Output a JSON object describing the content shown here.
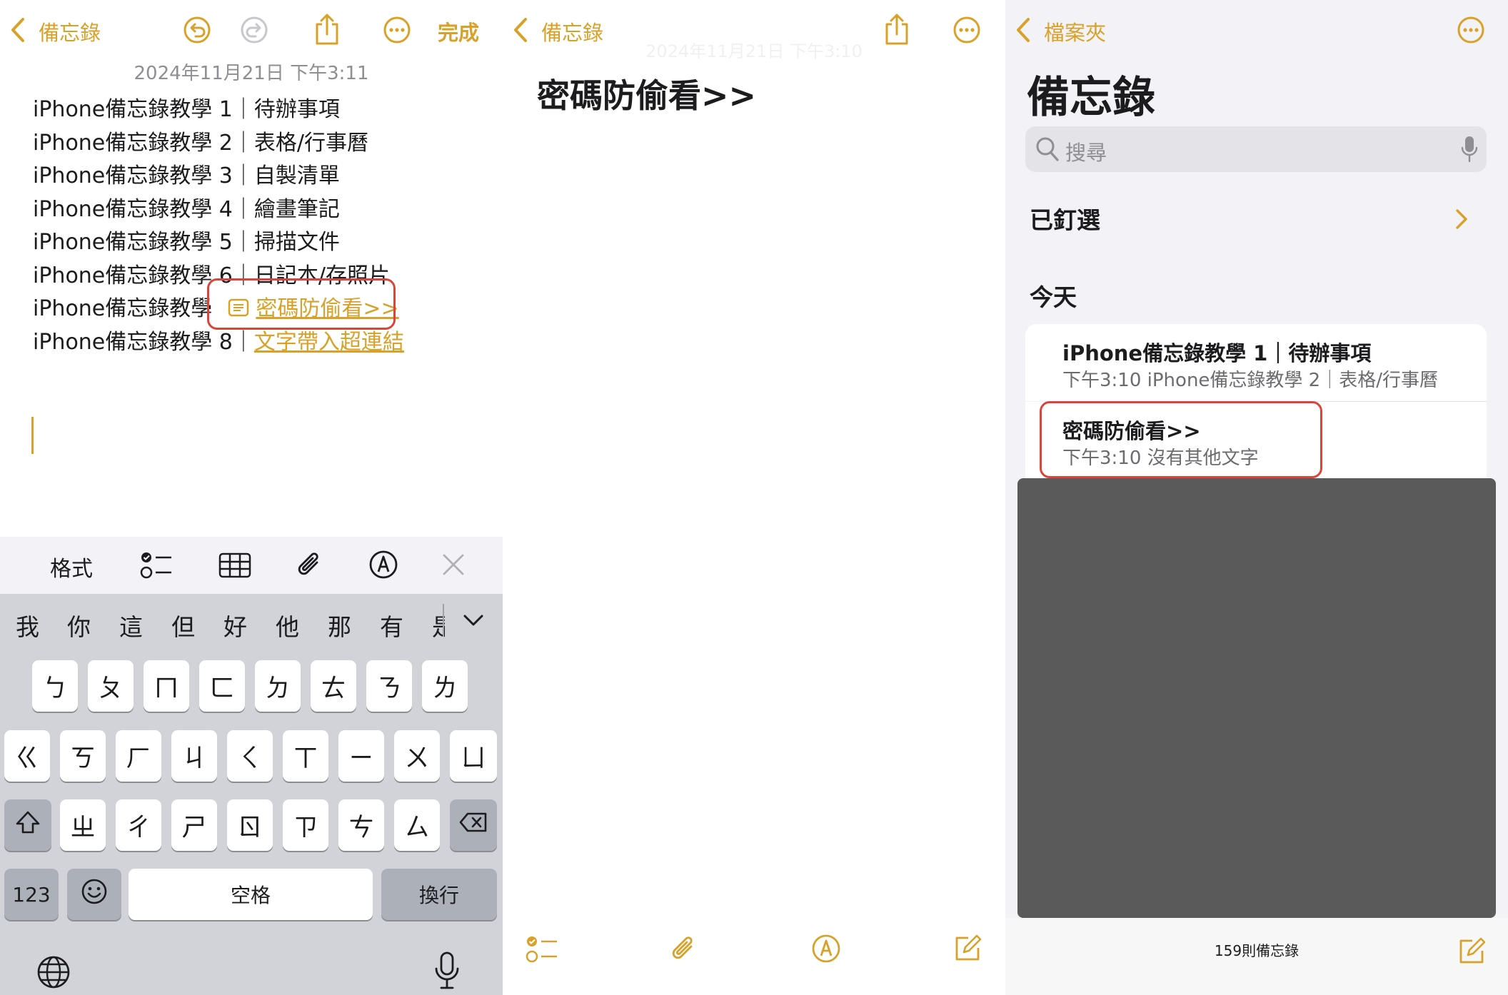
{
  "colors": {
    "accent": "#d8a22a",
    "highlight": "#d9453b",
    "overlay": "#5a5a5a"
  },
  "panel1": {
    "nav": {
      "back_label": "備忘錄",
      "done_label": "完成"
    },
    "date": "2024年11月21日 下午3:11",
    "lines": [
      {
        "prefix": "iPhone備忘錄教學 1｜待辦事項",
        "link": ""
      },
      {
        "prefix": "iPhone備忘錄教學 2｜表格/行事曆",
        "link": ""
      },
      {
        "prefix": "iPhone備忘錄教學 3｜自製清單",
        "link": ""
      },
      {
        "prefix": "iPhone備忘錄教學 4｜繪畫筆記",
        "link": ""
      },
      {
        "prefix": "iPhone備忘錄教學 5｜掃描文件",
        "link": ""
      },
      {
        "prefix": "iPhone備忘錄教學 6｜日記本/存照片",
        "link": ""
      },
      {
        "prefix": "iPhone備忘錄教學",
        "link": "密碼防偷看>>"
      },
      {
        "prefix": "iPhone備忘錄教學 8｜",
        "link": "文字帶入超連結"
      }
    ],
    "toolbar": {
      "format_label": "格式"
    },
    "keyboard": {
      "candidates": [
        "我",
        "你",
        "這",
        "但",
        "好",
        "他",
        "那",
        "有",
        "是"
      ],
      "row1": [
        "ㄅ",
        "ㄆ",
        "ㄇ",
        "ㄈ",
        "ㄉ",
        "ㄊ",
        "ㄋ",
        "ㄌ"
      ],
      "row2": [
        "ㄍ",
        "ㄎ",
        "ㄏ",
        "ㄐ",
        "ㄑ",
        "ㄒ",
        "ㄧ",
        "ㄨ",
        "ㄩ"
      ],
      "row3": [
        "ㄓ",
        "ㄔ",
        "ㄕ",
        "ㄖ",
        "ㄗ",
        "ㄘ",
        "ㄙ"
      ],
      "numbers_label": "123",
      "space_label": "空格",
      "return_label": "換行"
    }
  },
  "panel2": {
    "nav": {
      "back_label": "備忘錄"
    },
    "ghost_date": "2024年11月21日 下午3:10",
    "title": "密碼防偷看>>"
  },
  "panel3": {
    "nav": {
      "back_label": "檔案夾"
    },
    "title": "備忘錄",
    "search_placeholder": "搜尋",
    "pinned_label": "已釘選",
    "today_label": "今天",
    "notes": [
      {
        "title": "iPhone備忘錄教學 1｜待辦事項",
        "subtitle": "下午3:10  iPhone備忘錄教學 2｜表格/行事曆"
      },
      {
        "title": "密碼防偷看>>",
        "subtitle": "下午3:10  沒有其他文字"
      }
    ],
    "count_label": "159則備忘錄"
  }
}
